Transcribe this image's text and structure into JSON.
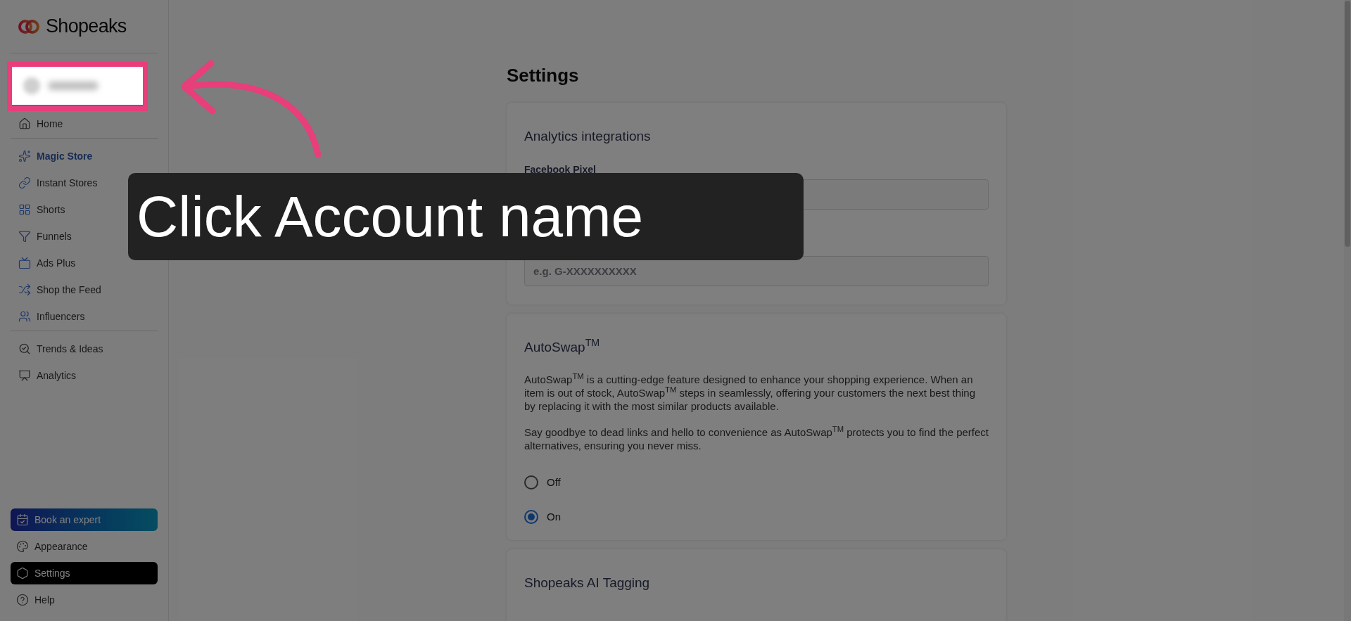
{
  "sidebar": {
    "logo": "Shopeaks",
    "nav_groups": [
      [
        {
          "label": "Home",
          "kind": "plain",
          "selected": false
        }
      ],
      [
        {
          "label": "Magic Store",
          "kind": "featured",
          "selected": false
        },
        {
          "label": "Instant Stores",
          "kind": "plain",
          "selected": false
        },
        {
          "label": "Shorts",
          "kind": "plain",
          "selected": false
        },
        {
          "label": "Funnels",
          "kind": "plain",
          "selected": false
        },
        {
          "label": "Ads Plus",
          "kind": "plain",
          "selected": false
        },
        {
          "label": "Shop the Feed",
          "kind": "plain",
          "selected": false
        },
        {
          "label": "Influencers",
          "kind": "plain",
          "selected": false
        }
      ],
      [
        {
          "label": "Trends & Ideas",
          "kind": "plain",
          "selected": false
        },
        {
          "label": "Analytics",
          "kind": "plain",
          "selected": false
        }
      ]
    ],
    "bottom_items": [
      {
        "label": "Book an expert",
        "kind": "cta",
        "selected": false
      },
      {
        "label": "Appearance",
        "kind": "plain",
        "selected": false
      },
      {
        "label": "Settings",
        "kind": "plain",
        "selected": true
      },
      {
        "label": "Help",
        "kind": "plain",
        "selected": false
      }
    ]
  },
  "page": {
    "title": "Settings",
    "cards": [
      {
        "kind": "fields",
        "title": "Analytics integrations",
        "fields": [
          {
            "label": "Facebook Pixel"
          },
          {
            "placeholder": "e.g. G-XXXXXXXXXX"
          }
        ]
      },
      {
        "kind": "radio",
        "title": "AutoSwap$^{TM}$",
        "paragraphs": [
          "AutoSwap$^{TM}$ is a cutting-edge feature designed to enhance your shopping experience. When an item is out of stock, AutoSwap$^{TM}$ steps in seamlessly, offering your customers the next best thing by replacing it with the most similar products available.",
          "Say goodbye to dead links and hello to convenience as AutoSwap$^{TM}$ protects you to find the perfect alternatives, ensuring you never miss."
        ],
        "options": [
          {
            "label": "Off",
            "selected": false
          },
          {
            "label": "On",
            "selected": true
          }
        ]
      },
      {
        "kind": "fields",
        "title": "Shopeaks AI Tagging"
      }
    ]
  },
  "tutorial": {
    "instruction": "Click Account name"
  }
}
